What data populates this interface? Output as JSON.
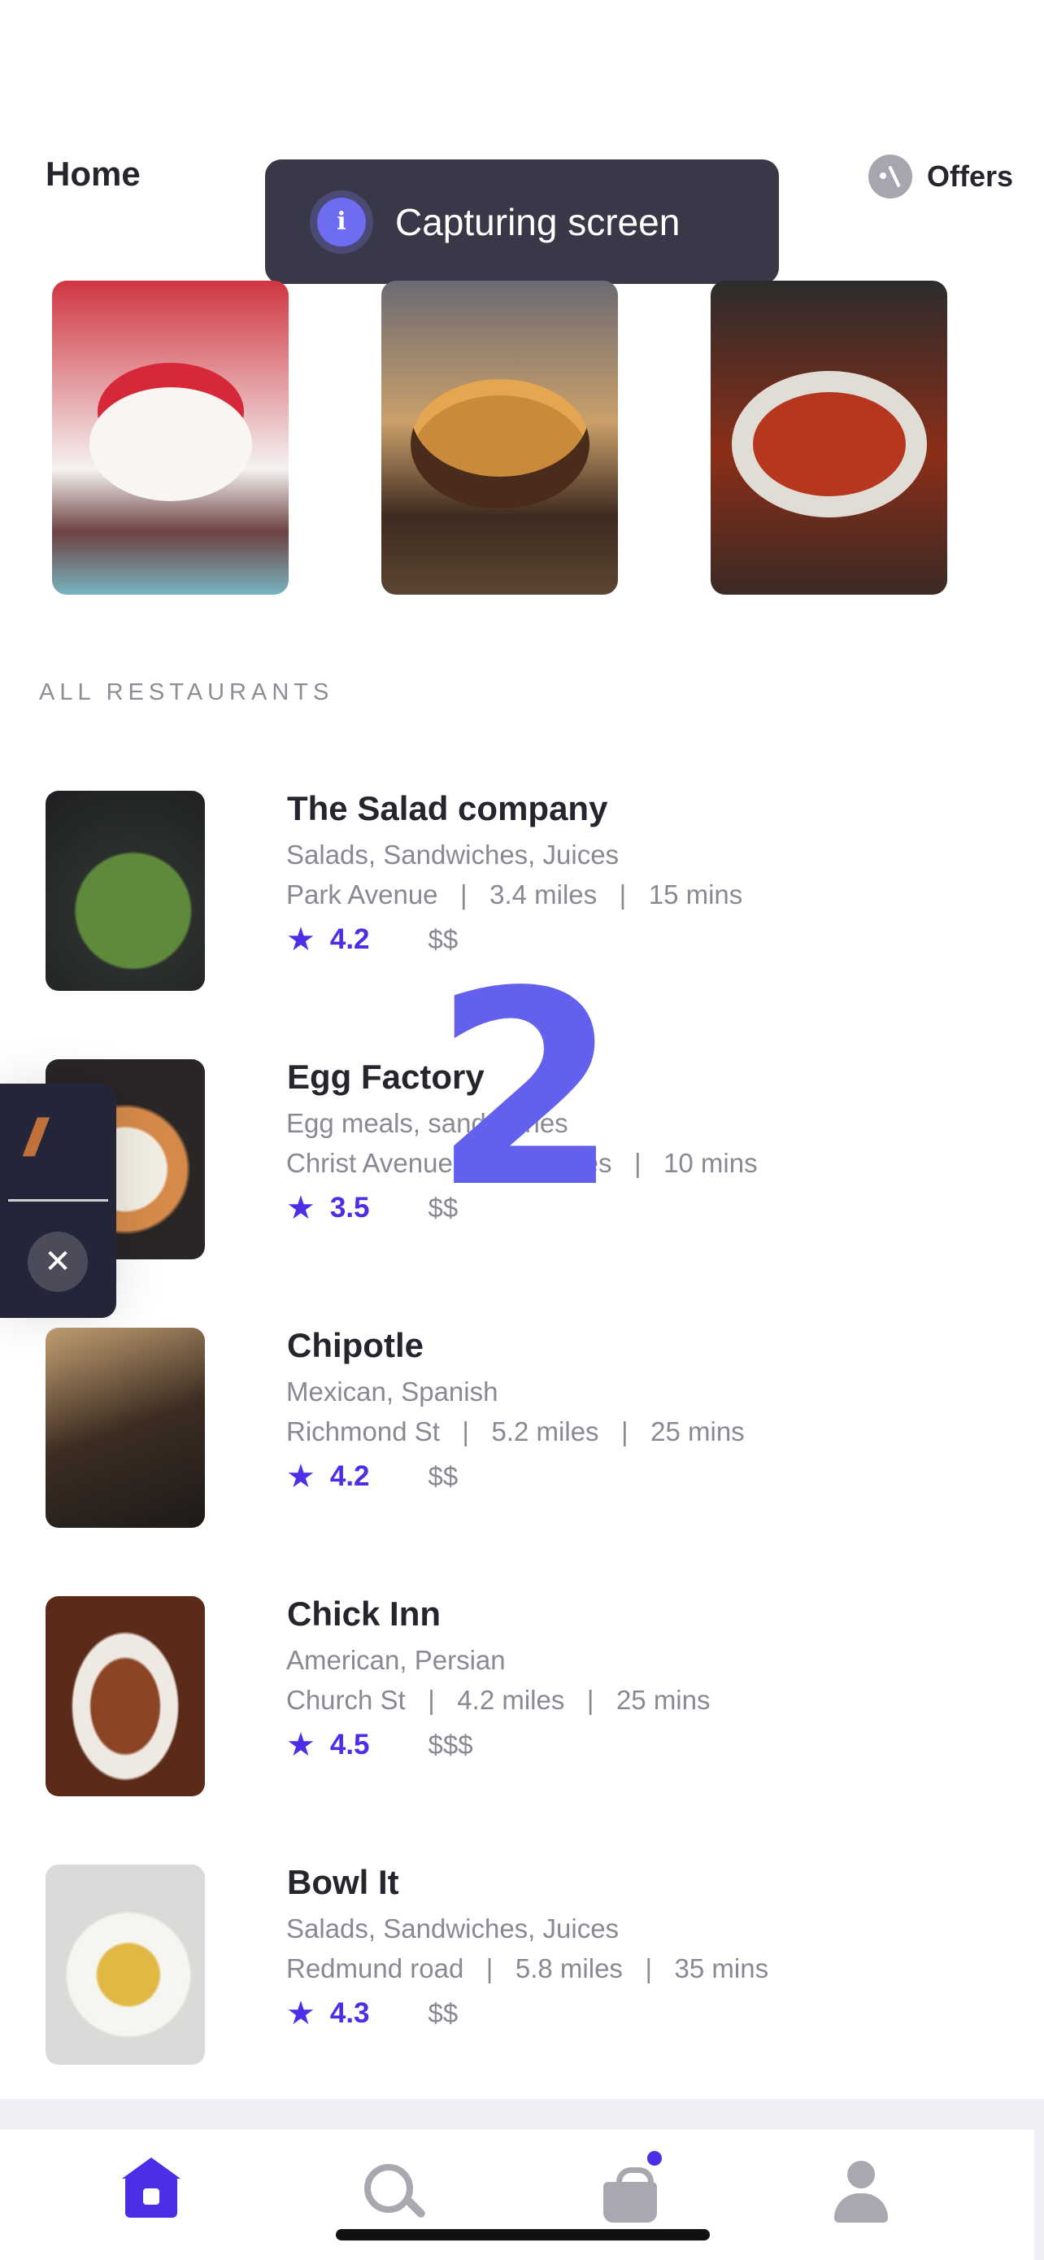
{
  "header": {
    "title": "Home",
    "offers_label": "Offers",
    "offers_icon": "discount-icon"
  },
  "toast": {
    "text": "Capturing screen",
    "icon_glyph": "i",
    "icon": "info-icon"
  },
  "featured": [
    {
      "name": "strawberry-cheesecake"
    },
    {
      "name": "burger"
    },
    {
      "name": "spaghetti-meatballs"
    }
  ],
  "section": {
    "title": "ALL RESTAURANTS"
  },
  "restaurants": [
    {
      "name": "The Salad company",
      "cuisine": "Salads, Sandwiches, Juices",
      "meta": "Park Avenue   |   3.4 miles   |   15 mins",
      "rating": "4.2",
      "price": "$$"
    },
    {
      "name": "Egg Factory",
      "cuisine": "Egg meals, sandwiches",
      "meta": "Christ Avenue   |   2.4 miles   |   10 mins",
      "rating": "3.5",
      "price": "$$"
    },
    {
      "name": "Chipotle",
      "cuisine": "Mexican, Spanish",
      "meta": "Richmond St   |   5.2 miles   |   25 mins",
      "rating": "4.2",
      "price": "$$"
    },
    {
      "name": "Chick Inn",
      "cuisine": "American, Persian",
      "meta": "Church St   |   4.2 miles   |   25 mins",
      "rating": "4.5",
      "price": "$$$"
    },
    {
      "name": "Bowl It",
      "cuisine": "Salads, Sandwiches, Juices",
      "meta": "Redmund road   |   5.8 miles   |   35 mins",
      "rating": "4.3",
      "price": "$$"
    }
  ],
  "overlay": {
    "countdown": "2"
  },
  "side_panel": {
    "close_glyph": "✕"
  },
  "tabbar": {
    "tabs": [
      "home",
      "search",
      "cart",
      "profile"
    ],
    "active": "home"
  },
  "colors": {
    "accent": "#4b2ee6",
    "toast_bg": "#393848",
    "countdown": "#6460ee"
  }
}
